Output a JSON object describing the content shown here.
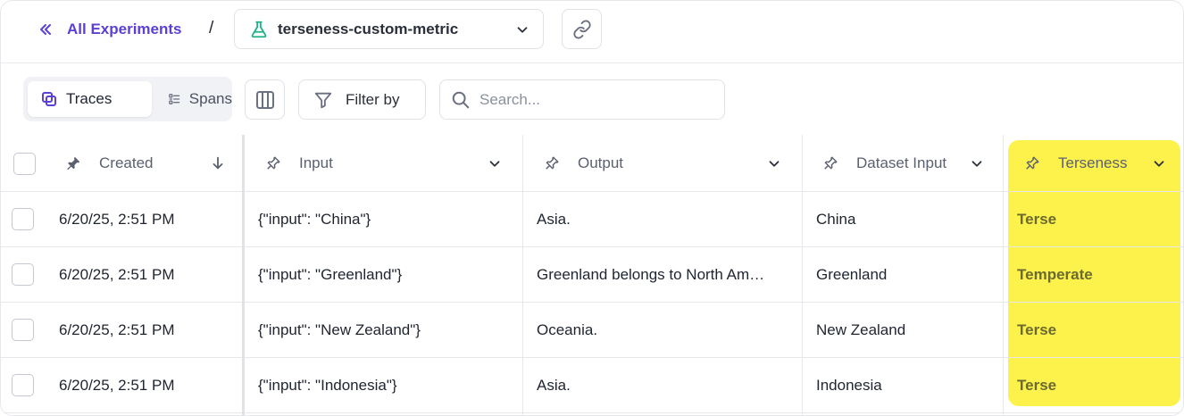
{
  "header": {
    "back_label": "All Experiments",
    "separator": "/",
    "experiment_name": "terseness-custom-metric"
  },
  "toolbar": {
    "tabs": [
      {
        "label": "Traces",
        "active": true
      },
      {
        "label": "Spans",
        "active": false
      }
    ],
    "filter_label": "Filter by",
    "search_placeholder": "Search..."
  },
  "table": {
    "columns": {
      "created": "Created",
      "input": "Input",
      "output": "Output",
      "dataset_input": "Dataset Input",
      "terseness": "Terseness"
    },
    "rows": [
      {
        "created": "6/20/25, 2:51 PM",
        "input": "{\"input\": \"China\"}",
        "output": "Asia.",
        "dataset_input": "China",
        "terseness": "Terse"
      },
      {
        "created": "6/20/25, 2:51 PM",
        "input": "{\"input\": \"Greenland\"}",
        "output": "Greenland belongs to North Am…",
        "dataset_input": "Greenland",
        "terseness": "Temperate"
      },
      {
        "created": "6/20/25, 2:51 PM",
        "input": "{\"input\": \"New Zealand\"}",
        "output": "Oceania.",
        "dataset_input": "New Zealand",
        "terseness": "Terse"
      },
      {
        "created": "6/20/25, 2:51 PM",
        "input": "{\"input\": \"Indonesia\"}",
        "output": "Asia.",
        "dataset_input": "Indonesia",
        "terseness": "Terse"
      }
    ]
  },
  "colors": {
    "accent": "#5b3fd6",
    "highlight": "#fdf24b",
    "flask": "#1fb28a"
  }
}
